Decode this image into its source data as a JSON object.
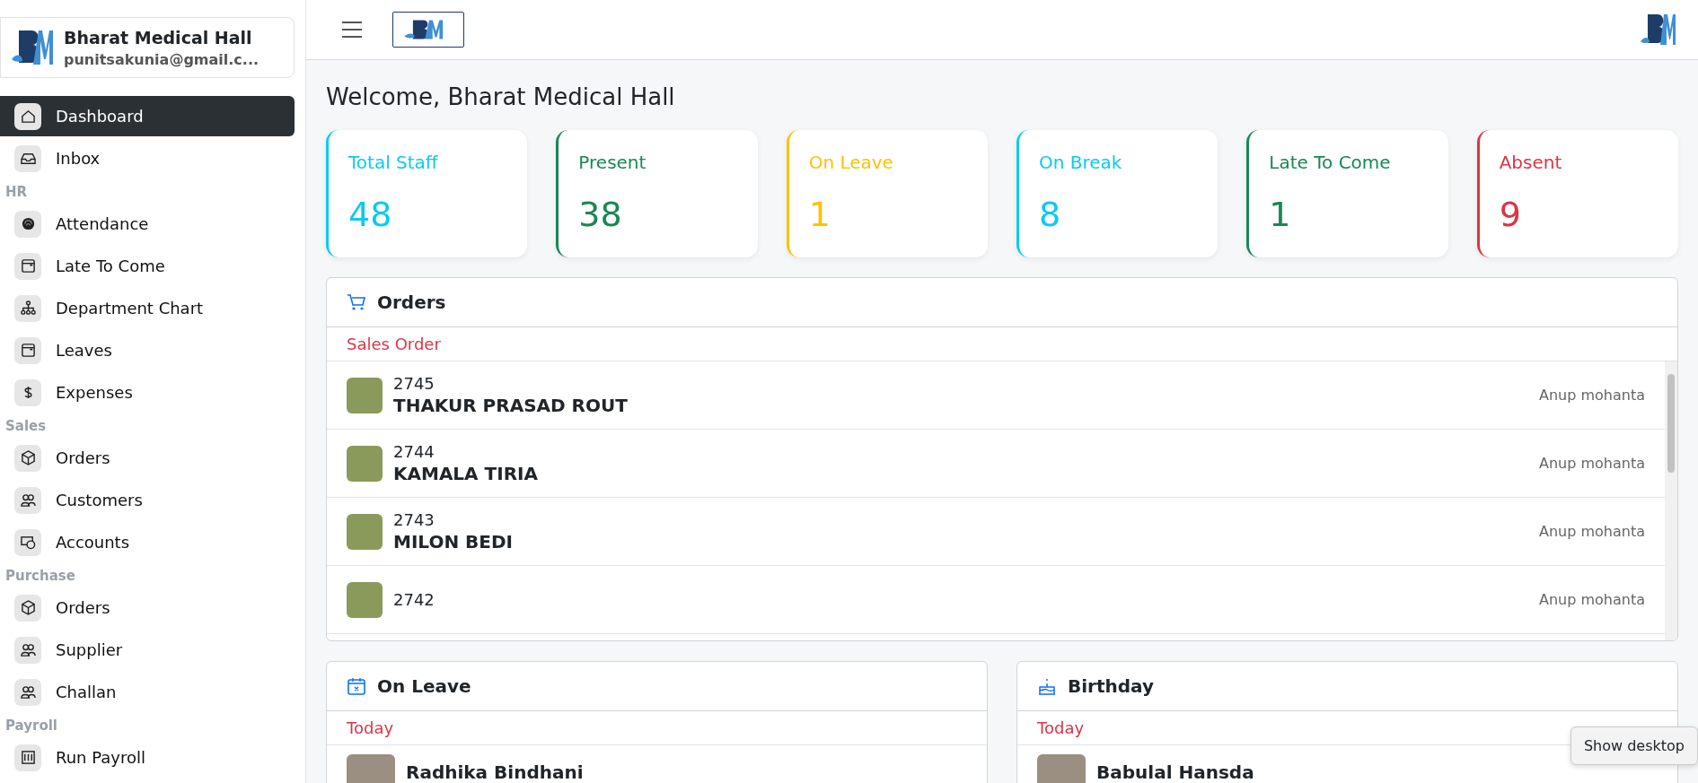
{
  "sidebar": {
    "profile": {
      "name": "Bharat Medical Hall",
      "email": "punitsakunia@gmail.c..."
    },
    "items": [
      {
        "kind": "link",
        "label": "Dashboard",
        "selected": true
      },
      {
        "kind": "link",
        "label": "Inbox",
        "selected": false
      },
      {
        "kind": "section",
        "label": "HR"
      },
      {
        "kind": "link",
        "label": "Attendance",
        "selected": false
      },
      {
        "kind": "link",
        "label": "Late To Come",
        "selected": false
      },
      {
        "kind": "link",
        "label": "Department Chart",
        "selected": false
      },
      {
        "kind": "link",
        "label": "Leaves",
        "selected": false
      },
      {
        "kind": "link",
        "label": "Expenses",
        "selected": false
      },
      {
        "kind": "section",
        "label": "Sales"
      },
      {
        "kind": "link",
        "label": "Orders",
        "selected": false
      },
      {
        "kind": "link",
        "label": "Customers",
        "selected": false
      },
      {
        "kind": "link",
        "label": "Accounts",
        "selected": false
      },
      {
        "kind": "section",
        "label": "Purchase"
      },
      {
        "kind": "link",
        "label": "Orders",
        "selected": false
      },
      {
        "kind": "link",
        "label": "Supplier",
        "selected": false
      },
      {
        "kind": "link",
        "label": "Challan",
        "selected": false
      },
      {
        "kind": "section",
        "label": "Payroll"
      },
      {
        "kind": "link",
        "label": "Run Payroll",
        "selected": false
      }
    ]
  },
  "header": {
    "title": "Welcome, Bharat Medical Hall"
  },
  "stats": [
    {
      "label": "Total Staff",
      "value": "48",
      "color": "#0dcaf0"
    },
    {
      "label": "Present",
      "value": "38",
      "color": "#198754"
    },
    {
      "label": "On Leave",
      "value": "1",
      "color": "#ffc107"
    },
    {
      "label": "On Break",
      "value": "8",
      "color": "#0dcaf0"
    },
    {
      "label": "Late To Come",
      "value": "1",
      "color": "#198754"
    },
    {
      "label": "Absent",
      "value": "9",
      "color": "#dc3545"
    }
  ],
  "orders": {
    "title": "Orders",
    "subtitle": "Sales Order",
    "rows": [
      {
        "number": "2745",
        "customer": "THAKUR PRASAD ROUT",
        "salesperson": "Anup mohanta"
      },
      {
        "number": "2744",
        "customer": "KAMALA TIRIA",
        "salesperson": "Anup mohanta"
      },
      {
        "number": "2743",
        "customer": "MILON BEDI",
        "salesperson": "Anup mohanta"
      },
      {
        "number": "2742",
        "salesperson": "Anup mohanta"
      }
    ]
  },
  "on_leave": {
    "title": "On Leave",
    "subtitle": "Today",
    "rows": [
      {
        "name": "Radhika Bindhani"
      }
    ]
  },
  "birthday": {
    "title": "Birthday",
    "subtitle": "Today",
    "rows": [
      {
        "name": "Babulal Hansda"
      }
    ]
  },
  "tooltip": "Show desktop"
}
